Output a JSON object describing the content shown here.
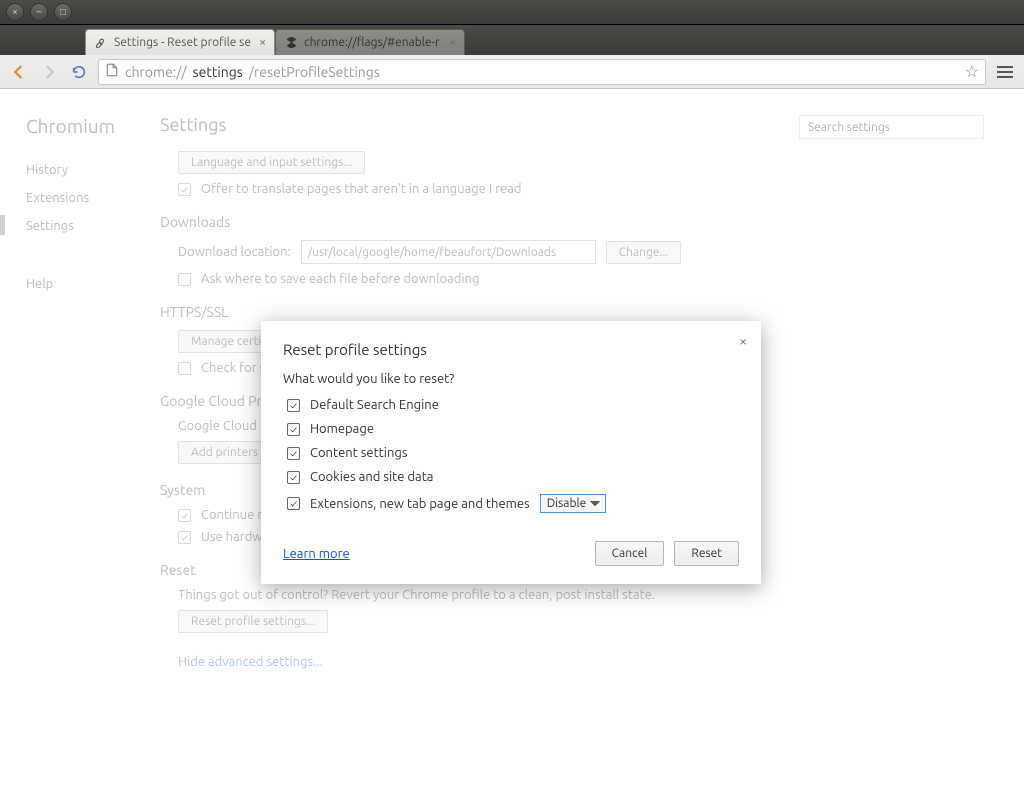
{
  "window": {
    "close": "×",
    "minimize": "–",
    "maximize": "□"
  },
  "tabs": [
    {
      "title": "Settings - Reset profile se",
      "close": "×"
    },
    {
      "title": "chrome://flags/#enable-r",
      "close": "×"
    }
  ],
  "toolbar": {
    "url_scheme": "chrome://",
    "url_host": "settings",
    "url_path": "/resetProfileSettings"
  },
  "sidebar": {
    "brand": "Chromium",
    "history": "History",
    "extensions": "Extensions",
    "settings": "Settings",
    "help": "Help"
  },
  "settings": {
    "title": "Settings",
    "search_placeholder": "Search settings",
    "lang_button": "Language and input settings...",
    "translate_label": "Offer to translate pages that aren't in a language I read",
    "downloads_h": "Downloads",
    "download_loc_label": "Download location:",
    "download_loc_value": "/usr/local/google/home/fbeaufort/Downloads",
    "change_btn": "Change...",
    "ask_where": "Ask where to save each file before downloading",
    "https_h": "HTTPS/SSL",
    "manage_cert": "Manage certi",
    "check_rev": "Check for se",
    "gcp_h": "Google Cloud Pr",
    "gcp_desc": "Google Cloud P",
    "add_printers": "Add printers",
    "system_h": "System",
    "bg_apps": "Continue running background apps when Chromium is closed",
    "hw_accel": "Use hardware acceleration when available",
    "reset_h": "Reset",
    "reset_desc": "Things got out of control? Revert your Chrome profile to a clean, post install state.",
    "reset_btn": "Reset profile settings...",
    "hide_adv": "Hide advanced settings..."
  },
  "modal": {
    "title": "Reset profile settings",
    "question": "What would you like to reset?",
    "opts": {
      "search": "Default Search Engine",
      "home": "Homepage",
      "content": "Content settings",
      "cookies": "Cookies and site data",
      "ext": "Extensions, new tab page and themes"
    },
    "select_value": "Disable",
    "learn_more": "Learn more",
    "cancel": "Cancel",
    "reset": "Reset"
  }
}
